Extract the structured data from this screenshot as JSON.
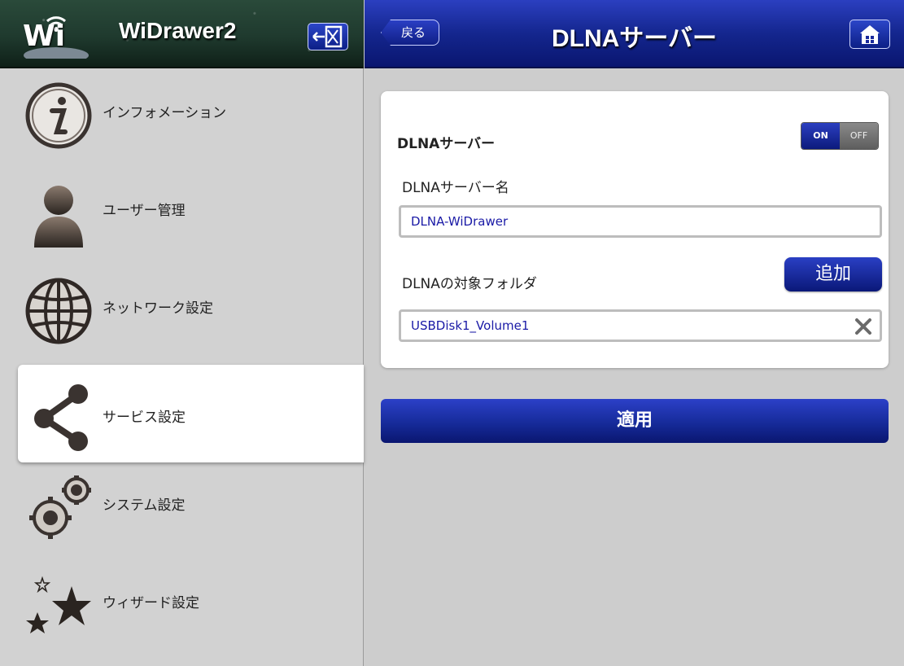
{
  "sidebar": {
    "logo_text": "Wi",
    "title": "WiDrawer2",
    "items": [
      {
        "label": "インフォメーション",
        "icon": "info-icon"
      },
      {
        "label": "ユーザー管理",
        "icon": "user-icon"
      },
      {
        "label": "ネットワーク設定",
        "icon": "globe-icon"
      },
      {
        "label": "サービス設定",
        "icon": "share-icon",
        "active": true
      },
      {
        "label": "システム設定",
        "icon": "gears-icon"
      },
      {
        "label": "ウィザード設定",
        "icon": "stars-icon"
      }
    ]
  },
  "header": {
    "back_label": "戻る",
    "title": "DLNAサーバー"
  },
  "form": {
    "dlna_label": "DLNAサーバー",
    "toggle_on": "ON",
    "toggle_off": "OFF",
    "server_name_label": "DLNAサーバー名",
    "server_name_value": "DLNA-WiDrawer",
    "folder_label": "DLNAの対象フォルダ",
    "add_label": "追加",
    "folder_value": "USBDisk1_Volume1",
    "apply_label": "適用"
  },
  "colors": {
    "accent_blue": "#14268e",
    "input_text": "#1a1aa6",
    "sidebar_bg": "#d2d2d2"
  }
}
